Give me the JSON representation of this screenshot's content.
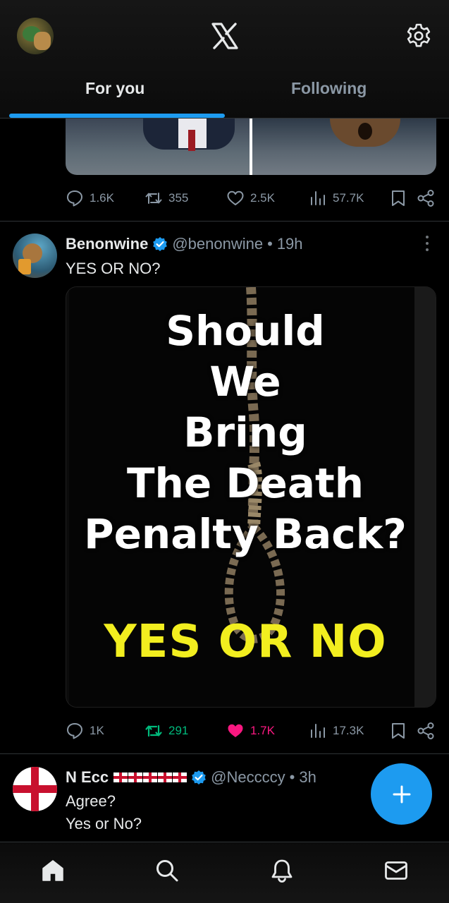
{
  "header": {
    "tabs": [
      {
        "label": "For you",
        "active": true
      },
      {
        "label": "Following",
        "active": false
      }
    ],
    "accent_color": "#1d9bf0"
  },
  "posts": [
    {
      "media_partial": true,
      "stats": {
        "replies": "1.6K",
        "reposts": "355",
        "likes": "2.5K",
        "views": "57.7K",
        "liked": false
      }
    },
    {
      "author": "Benonwine",
      "handle": "@benonwine",
      "time": "19h",
      "verified": true,
      "text": "YES OR NO?",
      "media": {
        "question": "Should\nWe\nBring\nThe Death\nPenalty Back?",
        "answer": "YES OR NO"
      },
      "stats": {
        "replies": "1K",
        "reposts": "291",
        "likes": "1.7K",
        "views": "17.3K",
        "liked": true,
        "reposted": true
      }
    },
    {
      "author": "N Ecc",
      "handle": "@Neccccy",
      "time": "3h",
      "verified": true,
      "flags": [
        "england-flag-icon",
        "england-flag-icon",
        "england-flag-icon",
        "england-flag-icon",
        "england-flag-icon"
      ],
      "text_lines": [
        "Agree?",
        "Yes or No?"
      ]
    }
  ],
  "separator": "•",
  "colors": {
    "like_active": "#f91880",
    "repost_active": "#00ba7c",
    "muted": "#8b98a5",
    "media_answer": "#f2ee1f"
  },
  "icons": {
    "header": [
      "avatar",
      "x-logo-icon",
      "settings-gear-icon"
    ],
    "actions": [
      "reply-icon",
      "repost-icon",
      "like-icon",
      "views-icon",
      "bookmark-icon",
      "share-icon"
    ],
    "nav": [
      "home-icon",
      "search-icon",
      "notifications-icon",
      "messages-icon"
    ],
    "fab": "plus-icon"
  }
}
